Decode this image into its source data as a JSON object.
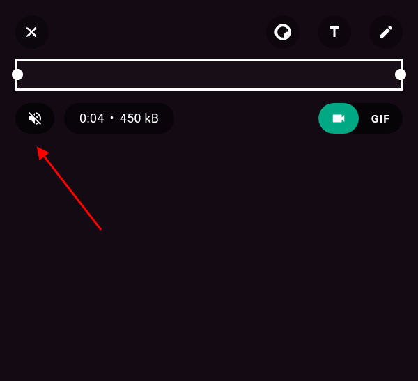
{
  "meta": {
    "duration": "0:04",
    "size": "450 kB",
    "separator": "•"
  },
  "toggle": {
    "gif_label": "GIF"
  }
}
